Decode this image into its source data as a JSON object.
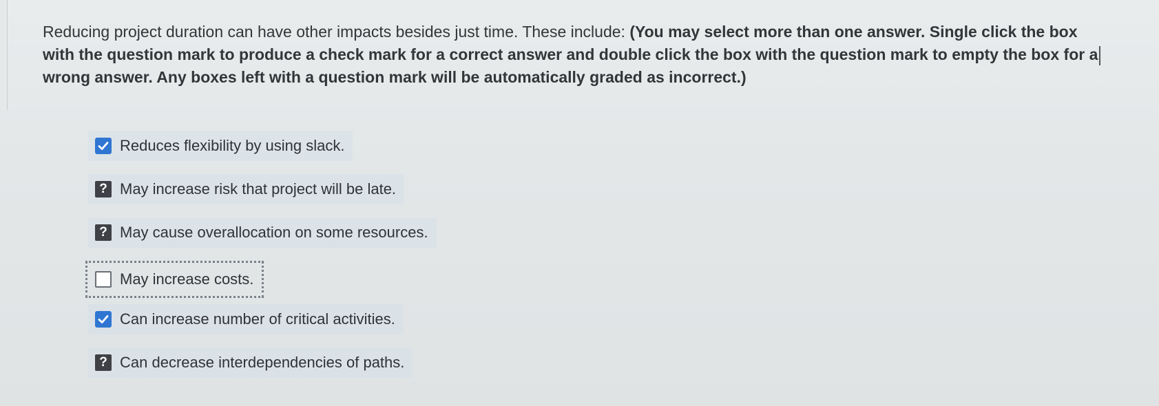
{
  "question": {
    "prefix": "Reducing project duration can have other impacts besides just time. These include: ",
    "instructions_part1": "(You may select more than one answer. Single click the box with the question mark to produce a check mark for a correct answer and double click the box with the question mark to empty the box for a",
    "instructions_part2": "wrong answer. Any boxes left with a question mark will be automatically graded as incorrect.)"
  },
  "answers": [
    {
      "state": "checked",
      "box_symbol": "",
      "label": "Reduces flexibility by using slack."
    },
    {
      "state": "question",
      "box_symbol": "?",
      "label": "May increase risk that project will be late."
    },
    {
      "state": "question",
      "box_symbol": "?",
      "label": "May cause overallocation on some resources."
    },
    {
      "state": "empty",
      "box_symbol": "",
      "label": "May increase costs."
    },
    {
      "state": "checked",
      "box_symbol": "",
      "label": "Can increase number of critical activities."
    },
    {
      "state": "question",
      "box_symbol": "?",
      "label": "Can decrease interdependencies of paths."
    }
  ],
  "colors": {
    "checked_box": "#2f76d2",
    "question_box": "#3f4146",
    "answer_highlight": "#d6e0ea",
    "background": "#e5e8e9"
  }
}
